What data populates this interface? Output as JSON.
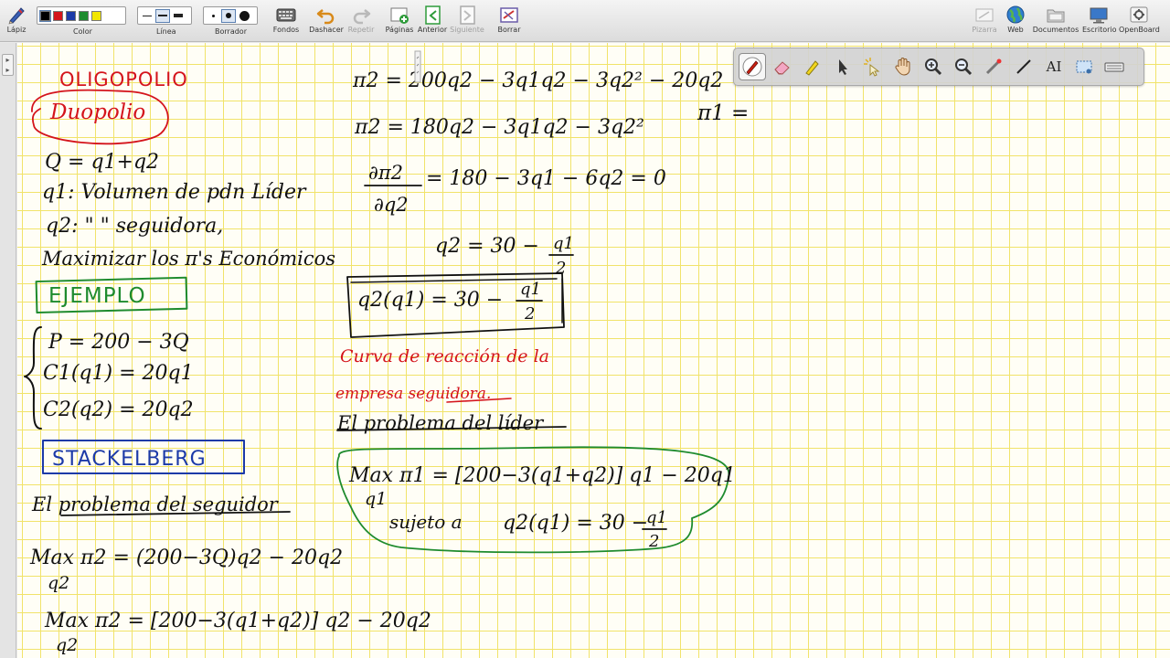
{
  "toolbar": {
    "pencil_label": "Lápiz",
    "color_label": "Color",
    "colors": [
      "#000000",
      "#d4141c",
      "#1c3aa8",
      "#1e8b2e",
      "#f2e600"
    ],
    "line_label": "Línea",
    "eraser_label": "Borrador",
    "backgrounds_label": "Fondos",
    "undo_label": "Dashacer",
    "redo_label": "Repetir",
    "pages_label": "Páginas",
    "previous_label": "Anterior",
    "next_label": "Siguiente",
    "clear_label": "Borrar",
    "board_label": "Pizarra",
    "web_label": "Web",
    "documents_label": "Documentos",
    "desktop_label": "Escritorio",
    "openboard_label": "OpenBoard"
  },
  "palette": {
    "tools": [
      "pen-icon",
      "eraser-icon",
      "marker-icon",
      "pointer-icon",
      "laser-icon",
      "hand-icon",
      "zoom-in-icon",
      "zoom-out-icon",
      "pointer-laser-icon",
      "line-icon",
      "text-tool-icon",
      "capture-icon",
      "keyboard-icon"
    ],
    "text_tool_label": "AI"
  },
  "board": {
    "left": {
      "title_oligopolio": "OLIGOPOLIO",
      "title_duopolio": "Duopolio",
      "line_q": "Q = q1+q2",
      "line_q1": "q1: Volumen de pdn Líder",
      "line_q2": "q2:  \"       \"  seguidora,",
      "line_max": "Maximizar los π's Económicos",
      "ejemplo": "EJEMPLO",
      "eq_p": "P = 200 − 3Q",
      "eq_c1": "C1(q1) = 20q1",
      "eq_c2": "C2(q2) = 20q2",
      "stackelberg": "STACKELBERG",
      "follower_problem": "El problema del seguidor",
      "max1": "Max π2 = (200−3Q)q2 − 20q2",
      "max1_sub": "q2",
      "max2": "Max π2 = [200−3(q1+q2)] q2 − 20q2",
      "max2_sub": "q2"
    },
    "middle": {
      "pi2_a": "π2 = 200q2 − 3q1q2 − 3q2² − 20q2",
      "pi2_b": "π2 = 180q2 − 3q1q2 − 3q2²",
      "deriv_num": "∂π2",
      "deriv_den": "∂q2",
      "deriv_rhs": "= 180 − 3q1 − 6q2 = 0",
      "q2_lhs": "q2 = 30 −",
      "frac_num": "q1",
      "frac_den": "2",
      "boxed_lhs": "q2(q1) = 30 −",
      "reaction_1": "Curva de reacción de la",
      "reaction_2": "empresa seguidora.",
      "leader_problem": "El problema del líder",
      "leader_max": "Max π1 = [200−3(q1+q2)] q1 − 20q1",
      "leader_sub": "q1",
      "subject_to": "sujeto a",
      "constraint": "q2(q1) = 30 −"
    },
    "right": {
      "pi1": "π1 ="
    }
  }
}
